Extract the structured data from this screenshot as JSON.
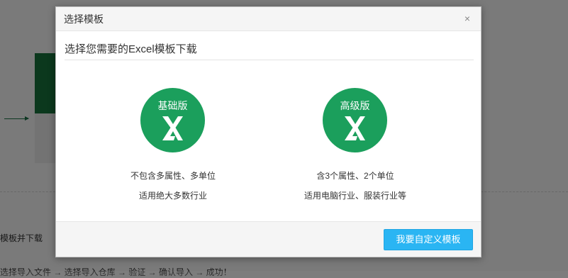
{
  "background": {
    "download_text": "模板并下载",
    "steps_text": "选择导入文件 → 选择导入仓库 → 验证 → 确认导入 → 成功！"
  },
  "modal": {
    "title": "选择模板",
    "close_icon": "×",
    "subtitle": "选择您需要的Excel模板下载",
    "templates": [
      {
        "name": "基础版",
        "icon": "excel-x-icon",
        "line1": "不包含多属性、多单位",
        "line2": "适用绝大多数行业"
      },
      {
        "name": "高级版",
        "icon": "excel-x-icon",
        "line1": "含3个属性、2个单位",
        "line2": "适用电脑行业、服装行业等"
      }
    ],
    "custom_button": "我要自定义模板"
  },
  "colors": {
    "accent_green": "#1b9f5c",
    "button_blue": "#2ab5f3",
    "background_dark_green": "#16713a"
  }
}
